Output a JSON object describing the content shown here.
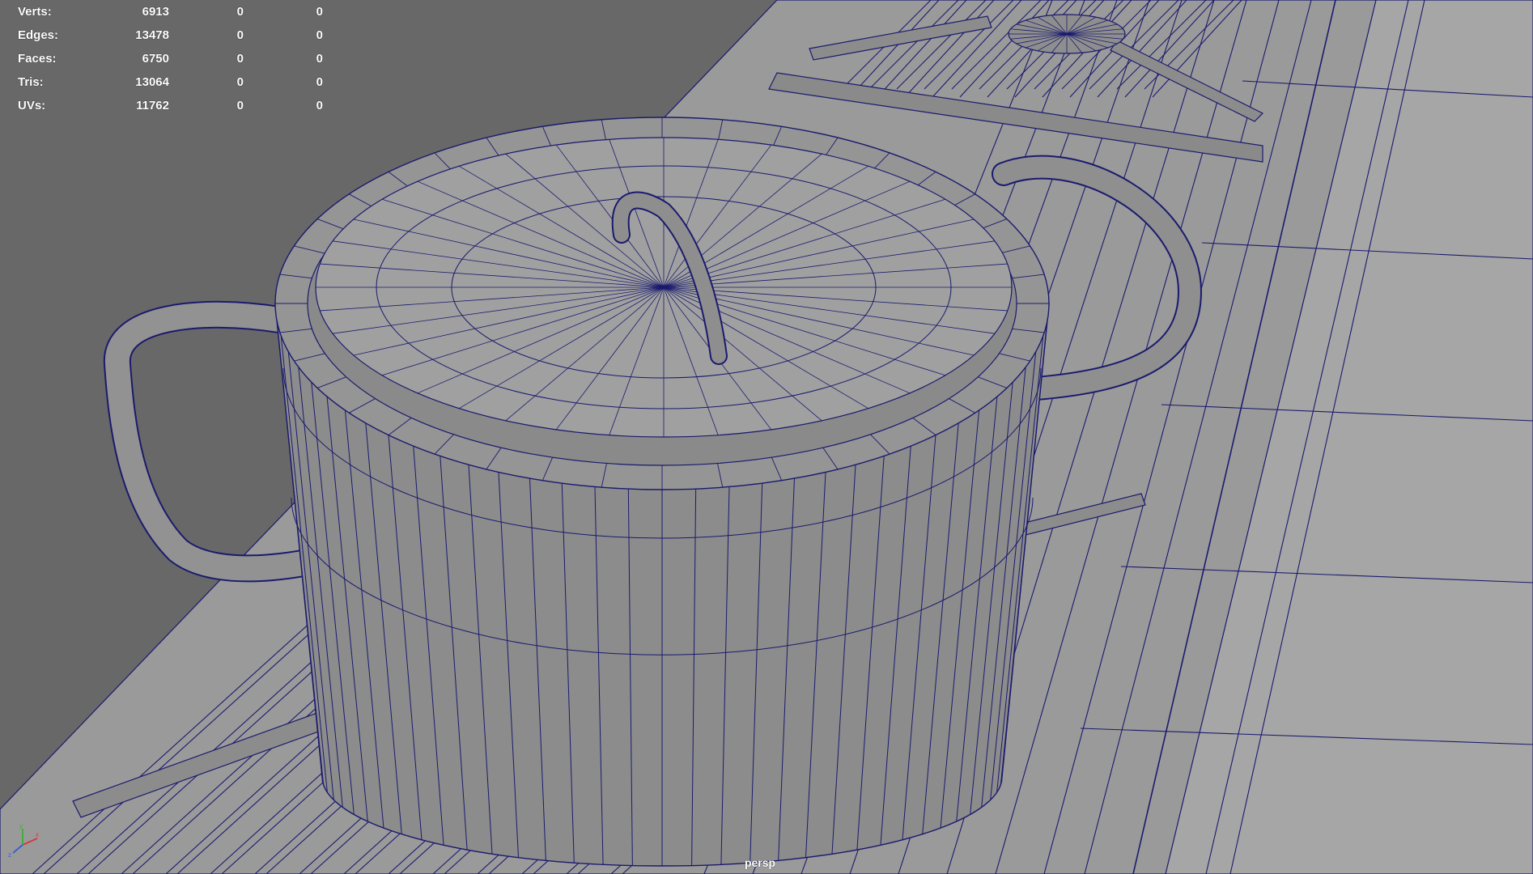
{
  "stats": {
    "rows": [
      {
        "label": "Verts:",
        "value": "6913",
        "selected": "0",
        "sub": "0"
      },
      {
        "label": "Edges:",
        "value": "13478",
        "selected": "0",
        "sub": "0"
      },
      {
        "label": "Faces:",
        "value": "6750",
        "selected": "0",
        "sub": "0"
      },
      {
        "label": "Tris:",
        "value": "13064",
        "selected": "0",
        "sub": "0"
      },
      {
        "label": "UVs:",
        "value": "11762",
        "selected": "0",
        "sub": "0"
      }
    ]
  },
  "viewport": {
    "camera": "persp",
    "background_color": "#686868",
    "wire_color": "#1a1a6e",
    "surface_color": "#8c8c8c"
  },
  "icons": {
    "gizmo": "axis-gizmo-icon"
  }
}
